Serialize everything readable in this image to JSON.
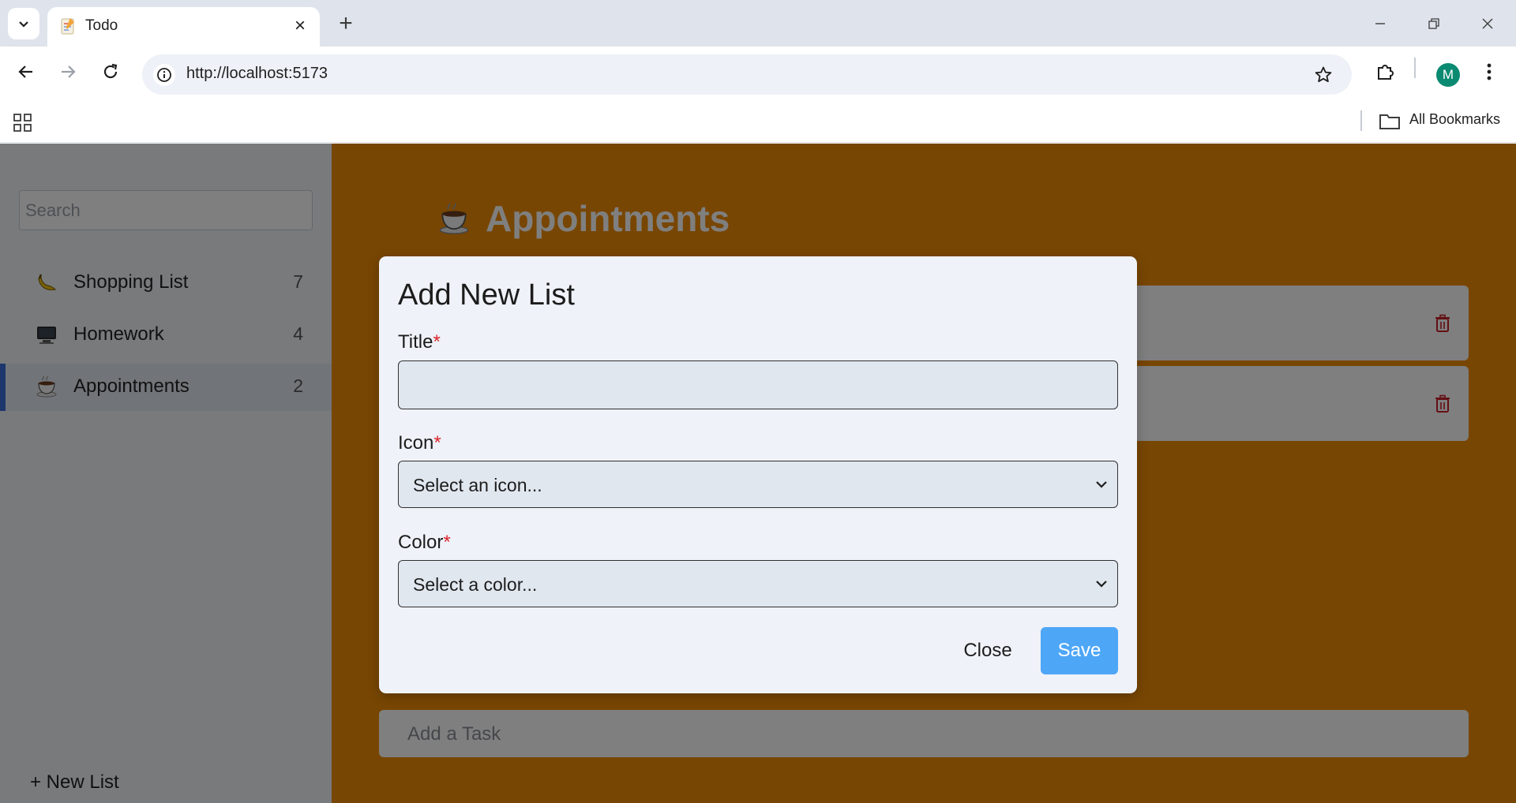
{
  "browser": {
    "tab_title": "Todo",
    "url": "http://localhost:5173",
    "profile_initial": "M",
    "bookmarks_label": "All Bookmarks"
  },
  "sidebar": {
    "search_placeholder": "Search",
    "lists": [
      {
        "label": "Shopping List",
        "count": "7",
        "icon": "banana-icon"
      },
      {
        "label": "Homework",
        "count": "4",
        "icon": "computer-icon"
      },
      {
        "label": "Appointments",
        "count": "2",
        "icon": "coffee-icon",
        "active": true
      }
    ],
    "new_list_label": "+ New List"
  },
  "main": {
    "title": "Appointments",
    "title_icon": "coffee-icon",
    "accent_color": "#f08c07",
    "add_task_placeholder": "Add a Task"
  },
  "modal": {
    "title": "Add New List",
    "title_label": "Title",
    "icon_label": "Icon",
    "icon_value": "Select an icon...",
    "color_label": "Color",
    "color_value": "Select a color...",
    "required_marker": "*",
    "close_label": "Close",
    "save_label": "Save"
  }
}
